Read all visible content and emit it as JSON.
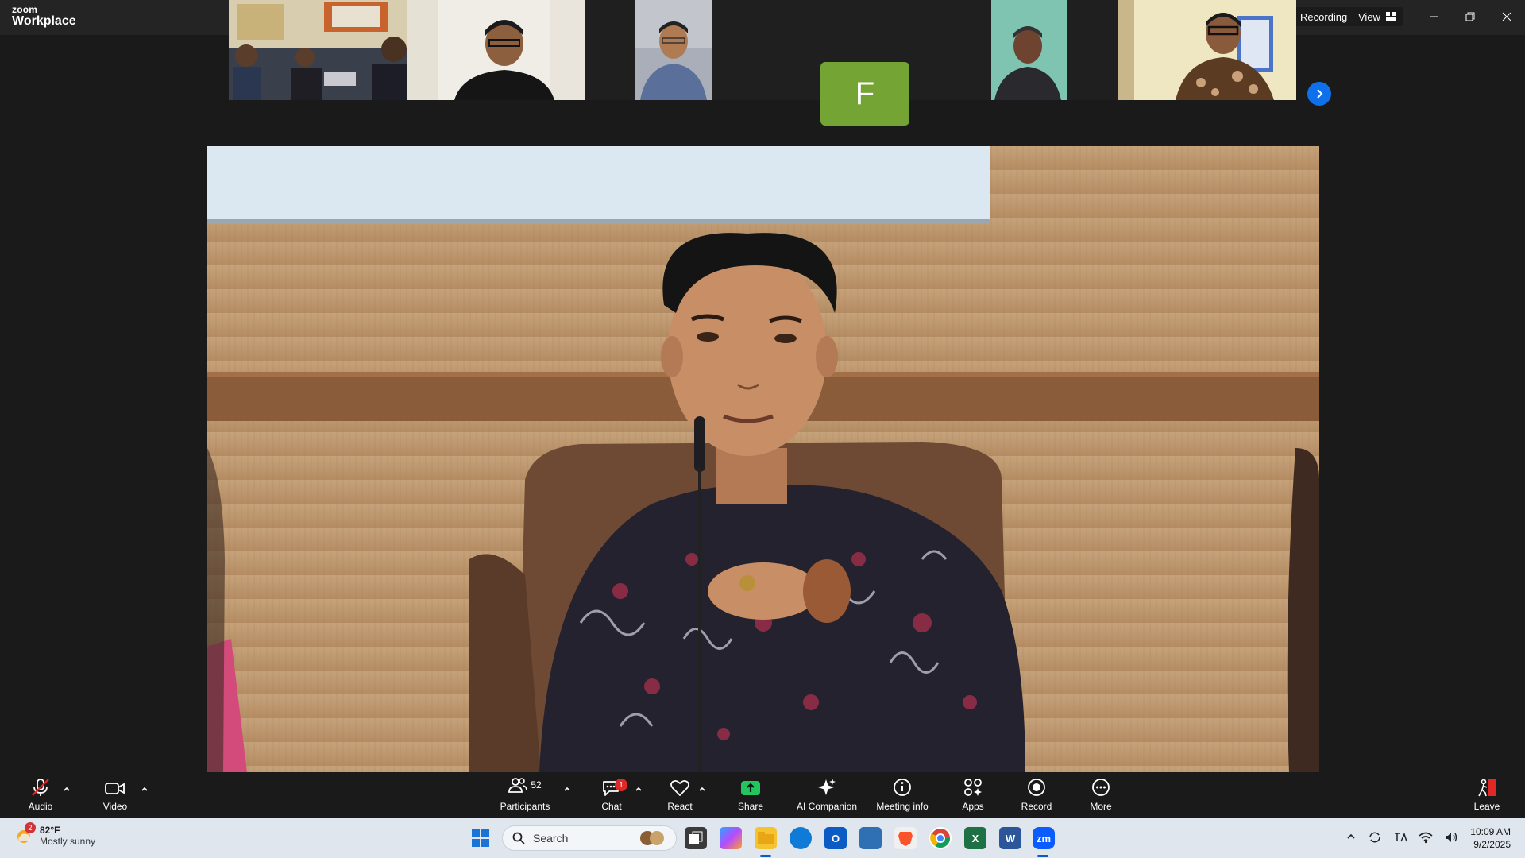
{
  "app": {
    "brand": "zoom",
    "product": "Workplace"
  },
  "titlebar": {
    "recording_label": "Recording",
    "view_label": "View",
    "record_dot_color": "#e5383b"
  },
  "participants_strip": {
    "tiles": [
      {
        "kind": "video",
        "description": "room with three men"
      },
      {
        "kind": "video",
        "description": "man with glasses, dark shirt"
      },
      {
        "kind": "video",
        "description": "older man, blue shirt"
      },
      {
        "kind": "avatar",
        "initial": "F",
        "color": "#74a434"
      },
      {
        "kind": "video",
        "description": "older man, dark shirt"
      },
      {
        "kind": "video",
        "description": "woman with glasses, batik"
      }
    ],
    "next_icon": "chevron-right-icon"
  },
  "toolbar": {
    "audio_label": "Audio",
    "video_label": "Video",
    "participants_label": "Participants",
    "participants_count": "52",
    "chat_label": "Chat",
    "chat_badge": "1",
    "react_label": "React",
    "share_label": "Share",
    "ai_label": "AI Companion",
    "meeting_info_label": "Meeting info",
    "apps_label": "Apps",
    "record_label": "Record",
    "more_label": "More",
    "leave_label": "Leave",
    "share_color": "#22c55e",
    "leave_color": "#e02828"
  },
  "taskbar": {
    "weather_temp": "82°F",
    "weather_cond": "Mostly sunny",
    "weather_badge": "2",
    "search_placeholder": "Search",
    "time": "10:09 AM",
    "date": "9/2/2025"
  }
}
